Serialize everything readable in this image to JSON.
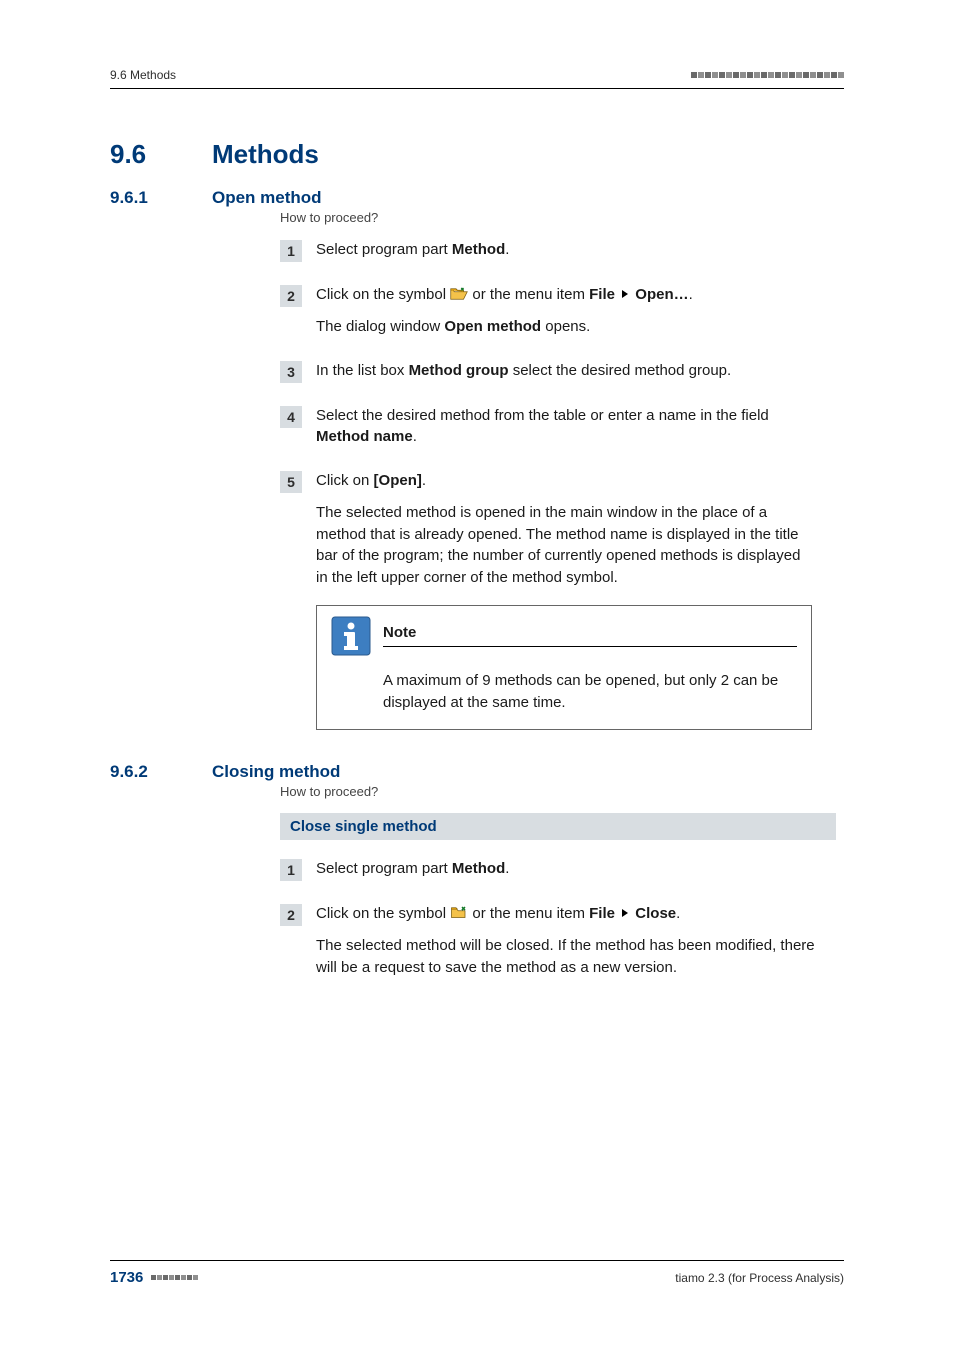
{
  "header": {
    "running_head": "9.6 Methods"
  },
  "section": {
    "num": "9.6",
    "title": "Methods"
  },
  "subsection1": {
    "num": "9.6.1",
    "title": "Open method",
    "howto": "How to proceed?",
    "steps": {
      "s1": {
        "n": "1",
        "a": "Select program part ",
        "b": "Method",
        "c": "."
      },
      "s2": {
        "n": "2",
        "a": "Click on the symbol ",
        "b": " or the menu item ",
        "file": "File",
        "open": "Open…",
        "dot": ".",
        "p2a": "The dialog window ",
        "p2b": "Open method",
        "p2c": " opens."
      },
      "s3": {
        "n": "3",
        "a": "In the list box ",
        "b": "Method group",
        "c": " select the desired method group."
      },
      "s4": {
        "n": "4",
        "a": "Select the desired method from the table or enter a name in the field ",
        "b": "Method name",
        "c": "."
      },
      "s5": {
        "n": "5",
        "a": "Click on ",
        "b": "[Open]",
        "c": ".",
        "p2": "The selected method is opened in the main window in the place of a method that is already opened. The method name is displayed in the title bar of the program; the number of currently opened methods is displayed in the left upper corner of the method symbol."
      }
    },
    "note": {
      "title": "Note",
      "body": "A maximum of 9 methods can be opened, but only 2 can be displayed at the same time."
    }
  },
  "subsection2": {
    "num": "9.6.2",
    "title": "Closing method",
    "howto": "How to proceed?",
    "proc_title": "Close single method",
    "steps": {
      "s1": {
        "n": "1",
        "a": "Select program part ",
        "b": "Method",
        "c": "."
      },
      "s2": {
        "n": "2",
        "a": "Click on the symbol ",
        "b": " or the menu item ",
        "file": "File",
        "close": "Close",
        "dot": ".",
        "p2": "The selected method will be closed. If the method has been modified, there will be a request to save the method as a new version."
      }
    }
  },
  "footer": {
    "page": "1736",
    "product": "tiamo 2.3 (for Process Analysis)"
  }
}
